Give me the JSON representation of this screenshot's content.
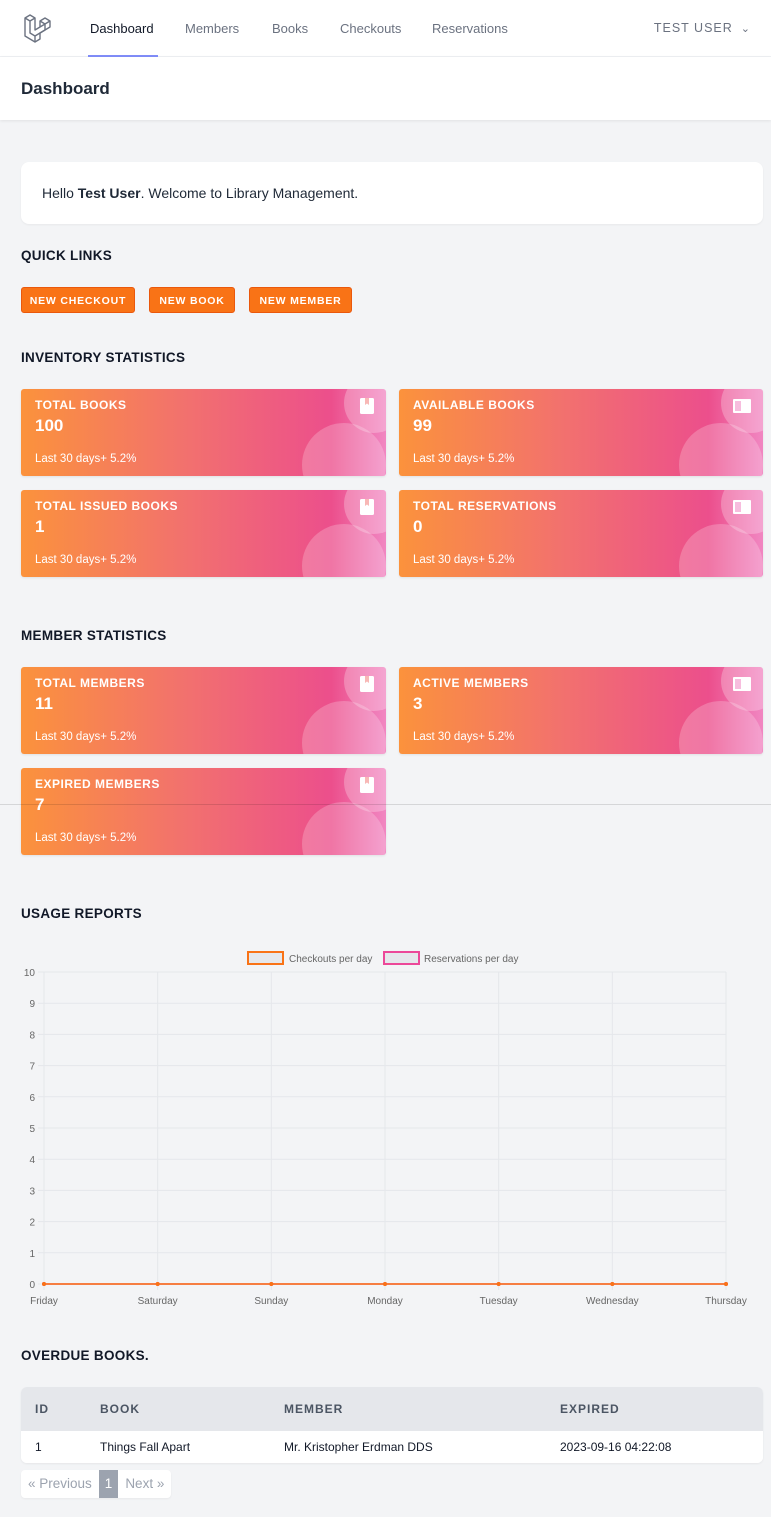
{
  "nav": {
    "links": [
      "Dashboard",
      "Members",
      "Books",
      "Checkouts",
      "Reservations"
    ],
    "active": "Dashboard",
    "user": "TEST USER"
  },
  "header": {
    "title": "Dashboard"
  },
  "welcome": {
    "prefix": "Hello ",
    "name": "Test User",
    "suffix": ". Welcome to Library Management."
  },
  "quick_links": {
    "title": "QUICK LINKS",
    "buttons": [
      "NEW CHECKOUT",
      "NEW BOOK",
      "NEW MEMBER"
    ]
  },
  "inventory": {
    "title": "INVENTORY STATISTICS",
    "cards": [
      {
        "label": "TOTAL BOOKS",
        "value": "100",
        "foot": "Last 30 days+ 5.2%",
        "icon": "book-icon"
      },
      {
        "label": "AVAILABLE BOOKS",
        "value": "99",
        "foot": "Last 30 days+ 5.2%",
        "icon": "book-open-icon"
      },
      {
        "label": "TOTAL ISSUED BOOKS",
        "value": "1",
        "foot": "Last 30 days+ 5.2%",
        "icon": "book-icon"
      },
      {
        "label": "TOTAL RESERVATIONS",
        "value": "0",
        "foot": "Last 30 days+ 5.2%",
        "icon": "book-open-icon"
      }
    ]
  },
  "members": {
    "title": "MEMBER STATISTICS",
    "cards": [
      {
        "label": "TOTAL MEMBERS",
        "value": "11",
        "foot": "Last 30 days+ 5.2%",
        "icon": "book-icon"
      },
      {
        "label": "ACTIVE MEMBERS",
        "value": "3",
        "foot": "Last 30 days+ 5.2%",
        "icon": "book-open-icon"
      },
      {
        "label": "EXPIRED MEMBERS",
        "value": "7",
        "foot": "Last 30 days+ 5.2%",
        "icon": "book-icon"
      }
    ]
  },
  "usage": {
    "title": "USAGE REPORTS"
  },
  "chart_data": {
    "type": "line",
    "categories": [
      "Friday",
      "Saturday",
      "Sunday",
      "Monday",
      "Tuesday",
      "Wednesday",
      "Thursday"
    ],
    "series": [
      {
        "name": "Checkouts per day",
        "values": [
          0,
          0,
          0,
          0,
          0,
          0,
          0
        ],
        "color": "#f97316"
      },
      {
        "name": "Reservations per day",
        "values": [
          0,
          0,
          0,
          0,
          0,
          0,
          0
        ],
        "color": "#ec4899"
      }
    ],
    "y_ticks": [
      "0",
      "1",
      "2",
      "3",
      "4",
      "5",
      "6",
      "7",
      "8",
      "9",
      "10"
    ],
    "ylim": [
      0,
      10
    ],
    "grid": true,
    "legend": "top-center"
  },
  "overdue": {
    "title": "OVERDUE BOOKS.",
    "headers": [
      "ID",
      "BOOK",
      "MEMBER",
      "EXPIRED"
    ],
    "rows": [
      [
        "1",
        "Things Fall Apart",
        "Mr. Kristopher Erdman DDS",
        "2023-09-16 04:22:08"
      ]
    ]
  },
  "pagination": {
    "prev": "« Previous",
    "current": "1",
    "next": "Next »"
  },
  "colors": {
    "accent": "#f97316",
    "card_start": "#fb923c",
    "card_end": "#ec4899",
    "nav_underline": "#818cf8"
  }
}
